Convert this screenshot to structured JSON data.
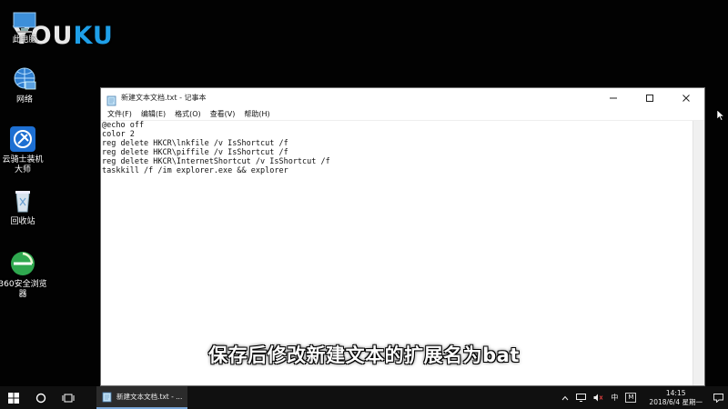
{
  "watermark": {
    "text_a": "YOU",
    "text_b": "KU"
  },
  "desktop_icons": [
    {
      "label": "此电脑"
    },
    {
      "label": "网络"
    },
    {
      "label": "云骑士装机\n大师"
    },
    {
      "label": "回收站"
    },
    {
      "label": "360安全浏览\n器"
    }
  ],
  "notepad": {
    "title": "新建文本文档.txt - 记事本",
    "menu": [
      "文件(F)",
      "编辑(E)",
      "格式(O)",
      "查看(V)",
      "帮助(H)"
    ],
    "content": "@echo off\ncolor 2\nreg delete HKCR\\lnkfile /v IsShortcut /f\nreg delete HKCR\\piffile /v IsShortcut /f\nreg delete HKCR\\InternetShortcut /v IsShortcut /f\ntaskkill /f /im explorer.exe && explorer"
  },
  "subtitle": "保存后修改新建文本的扩展名为bat",
  "taskbar": {
    "app_label": "新建文本文档.txt - ...",
    "ime": "中",
    "ime_mode": "M",
    "time": "14:15",
    "date": "2018/6/4 星期一"
  },
  "colors": {
    "accent": "#1e9fe8",
    "taskbar": "#101010"
  }
}
